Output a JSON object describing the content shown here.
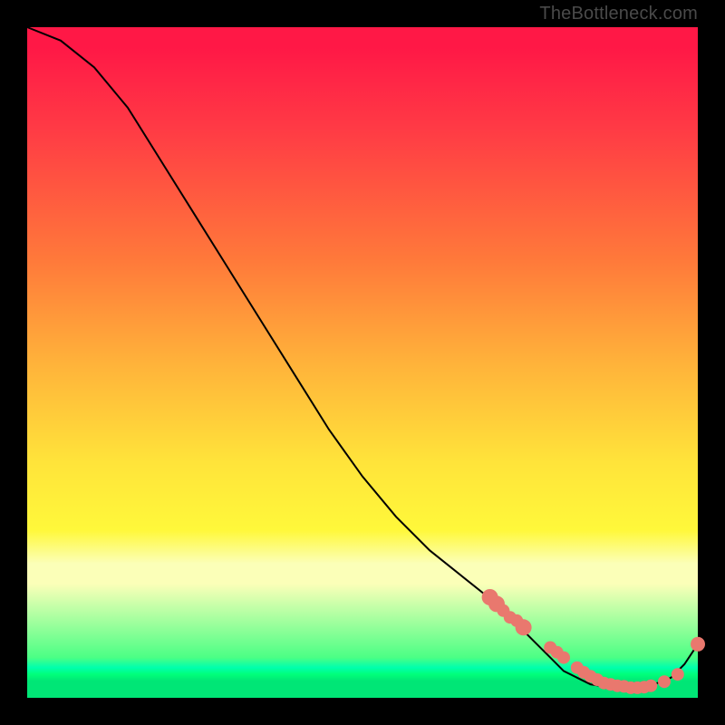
{
  "watermark": "TheBottleneck.com",
  "colors": {
    "dot": "#e9786e",
    "curve": "#000000",
    "bg": "#000000"
  },
  "chart_data": {
    "type": "line",
    "title": "",
    "xlabel": "",
    "ylabel": "",
    "xlim": [
      0,
      100
    ],
    "ylim": [
      0,
      100
    ],
    "grid": false,
    "legend": false,
    "series": [
      {
        "name": "bottleneck-curve",
        "x": [
          0,
          5,
          10,
          15,
          20,
          25,
          30,
          35,
          40,
          45,
          50,
          55,
          60,
          65,
          70,
          72,
          74,
          76,
          78,
          80,
          82,
          84,
          86,
          88,
          90,
          92,
          94,
          96,
          98,
          100
        ],
        "y": [
          100,
          98,
          94,
          88,
          80,
          72,
          64,
          56,
          48,
          40,
          33,
          27,
          22,
          18,
          14,
          12,
          10,
          8,
          6,
          4,
          3,
          2,
          1.7,
          1.5,
          1.5,
          1.8,
          2.2,
          3,
          5,
          8
        ]
      }
    ],
    "highlight_points": {
      "name": "gpu-points",
      "x": [
        69,
        70,
        71,
        72,
        73,
        74,
        78,
        79,
        80,
        82,
        83,
        84,
        85,
        86,
        87,
        88,
        89,
        90,
        91,
        92,
        93,
        95,
        97,
        100
      ],
      "y": [
        15,
        14,
        13,
        12,
        11.5,
        10.5,
        7.5,
        6.8,
        6.0,
        4.5,
        3.8,
        3.2,
        2.7,
        2.2,
        2.0,
        1.8,
        1.7,
        1.5,
        1.5,
        1.6,
        1.8,
        2.4,
        3.5,
        8.0
      ],
      "r": [
        9,
        9,
        7,
        7,
        7,
        9,
        7,
        7,
        7,
        7,
        7,
        7,
        7,
        7,
        7,
        7,
        7,
        7,
        7,
        7,
        7,
        7,
        7,
        8
      ]
    }
  }
}
